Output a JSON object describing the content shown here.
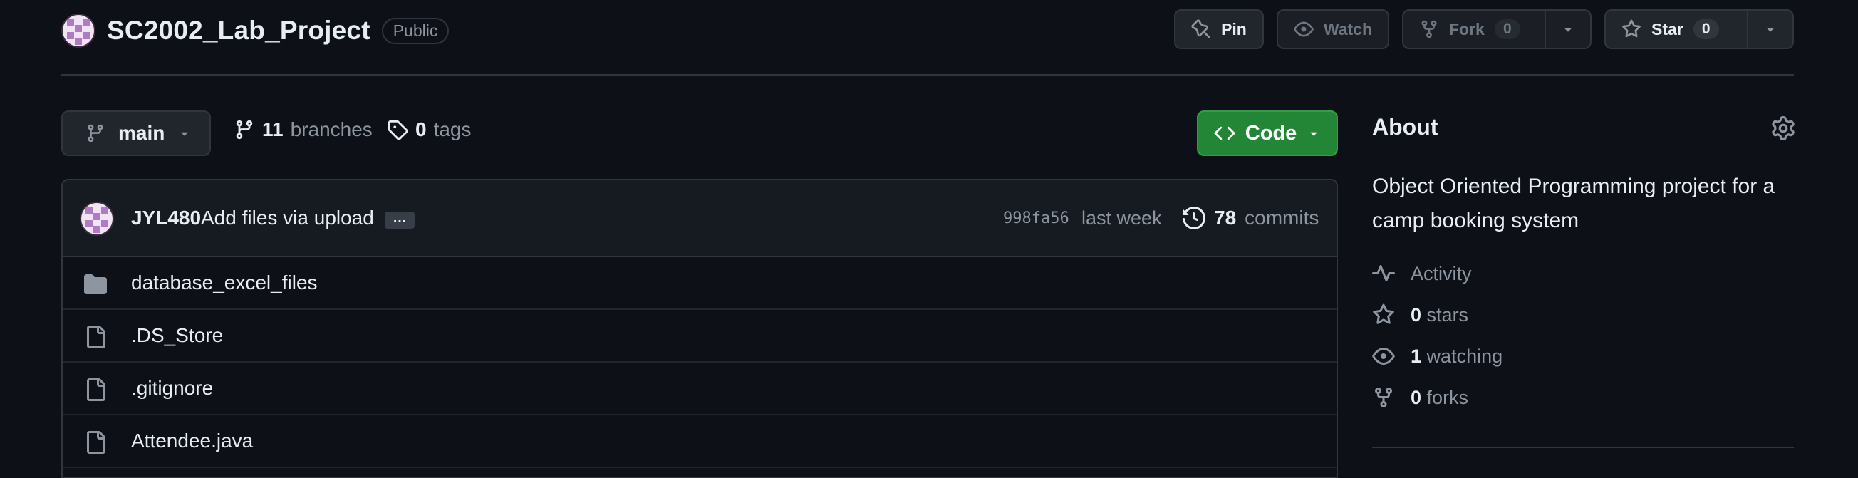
{
  "repo": {
    "name": "SC2002_Lab_Project",
    "visibility": "Public"
  },
  "actions": {
    "pin_label": "Pin",
    "watch_label": "Watch",
    "fork_label": "Fork",
    "fork_count": "0",
    "star_label": "Star",
    "star_count": "0"
  },
  "branch": {
    "current": "main",
    "branches_count": "11",
    "branches_label": "branches",
    "tags_count": "0",
    "tags_label": "tags"
  },
  "code_button": {
    "label": "Code"
  },
  "commit": {
    "author": "JYL480",
    "message": "Add files via upload",
    "ellipsis": "…",
    "sha": "998fa56",
    "time": "last week",
    "commits_count": "78",
    "commits_label": "commits"
  },
  "files": [
    {
      "name": "database_excel_files",
      "type": "folder"
    },
    {
      "name": ".DS_Store",
      "type": "file"
    },
    {
      "name": ".gitignore",
      "type": "file"
    },
    {
      "name": "Attendee.java",
      "type": "file"
    }
  ],
  "about": {
    "title": "About",
    "description": "Object Oriented Programming project for a camp booking system",
    "activity_label": "Activity",
    "stars_count": "0",
    "stars_label": "stars",
    "watching_count": "1",
    "watching_label": "watching",
    "forks_count": "0",
    "forks_label": "forks"
  },
  "colors": {
    "background": "#0d1117",
    "border": "#30363d",
    "muted_text": "#8d96a0",
    "code_button": "#238636",
    "avatar": "#b07bc4"
  }
}
